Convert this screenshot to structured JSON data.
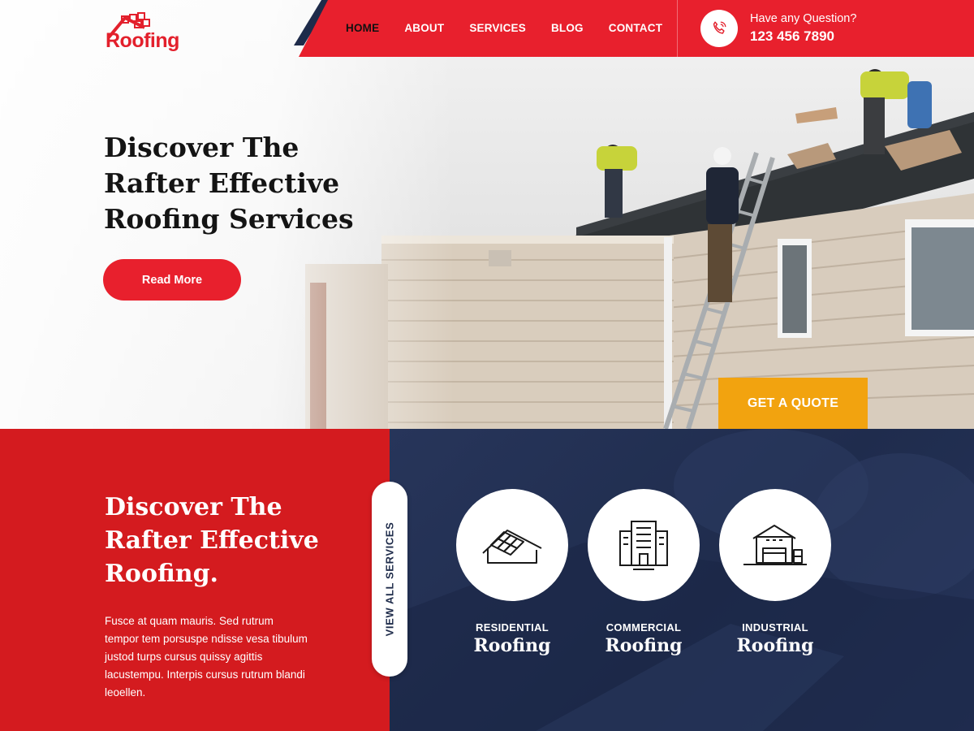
{
  "brand": {
    "logo_text": "Roofing"
  },
  "nav": {
    "items": [
      "HOME",
      "ABOUT",
      "SERVICES",
      "BLOG",
      "CONTACT"
    ],
    "active": "HOME"
  },
  "contact": {
    "question": "Have any Question?",
    "phone": "123 456 7890"
  },
  "hero": {
    "title": "Discover The Rafter Effective Roofing Services",
    "cta": "Read More",
    "quote_button": "GET A QUOTE"
  },
  "about": {
    "title": "Discover The Rafter Effective Roofing.",
    "text": "Fusce at quam mauris. Sed rutrum tempor tem porsuspe ndisse vesa tibulum justod turps cursus quissy agittis lacustempu. Interpis cursus rutrum blandi leoellen."
  },
  "services": {
    "view_all": "VIEW ALL SERVICES",
    "items": [
      {
        "category": "RESIDENTIAL",
        "name": "Roofing",
        "icon": "house-roof-icon"
      },
      {
        "category": "COMMERCIAL",
        "name": "Roofing",
        "icon": "building-icon"
      },
      {
        "category": "INDUSTRIAL",
        "name": "Roofing",
        "icon": "warehouse-icon"
      }
    ]
  },
  "colors": {
    "brand_red": "#e8202d",
    "navy": "#1e2b4a",
    "accent_orange": "#f2a30f"
  }
}
